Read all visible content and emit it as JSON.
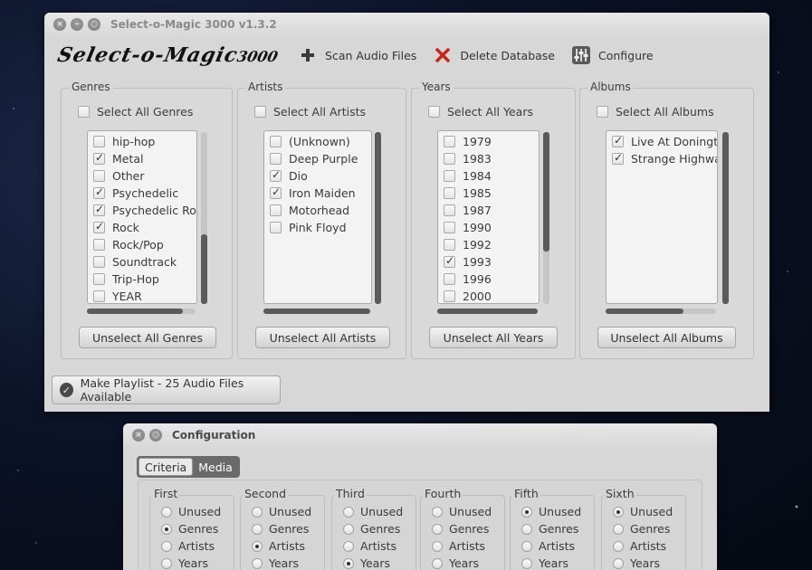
{
  "main_window": {
    "title": "Select-o-Magic 3000 v1.3.2",
    "logo": {
      "text": "Select-o-Magic",
      "num": "3000"
    },
    "toolbar": {
      "scan": "Scan Audio Files",
      "delete": "Delete Database",
      "configure": "Configure"
    },
    "panels": [
      {
        "label": "Genres",
        "select_all": "Select All Genres",
        "unselect_all": "Unselect All Genres",
        "items": [
          {
            "label": "hip-hop",
            "checked": false
          },
          {
            "label": "Metal",
            "checked": true
          },
          {
            "label": "Other",
            "checked": false
          },
          {
            "label": "Psychedelic",
            "checked": true
          },
          {
            "label": "Psychedelic Rock",
            "checked": true
          },
          {
            "label": "Rock",
            "checked": true
          },
          {
            "label": "Rock/Pop",
            "checked": false
          },
          {
            "label": "Soundtrack",
            "checked": false
          },
          {
            "label": "Trip-Hop",
            "checked": false
          },
          {
            "label": "YEAR",
            "checked": false
          }
        ]
      },
      {
        "label": "Artists",
        "select_all": "Select All Artists",
        "unselect_all": "Unselect All Artists",
        "items": [
          {
            "label": "(Unknown)",
            "checked": false
          },
          {
            "label": "Deep Purple",
            "checked": false
          },
          {
            "label": "Dio",
            "checked": true
          },
          {
            "label": "Iron Maiden",
            "checked": true
          },
          {
            "label": "Motorhead",
            "checked": false
          },
          {
            "label": "Pink Floyd",
            "checked": false
          }
        ]
      },
      {
        "label": "Years",
        "select_all": "Select All Years",
        "unselect_all": "Unselect All Years",
        "items": [
          {
            "label": "1979",
            "checked": false
          },
          {
            "label": "1983",
            "checked": false
          },
          {
            "label": "1984",
            "checked": false
          },
          {
            "label": "1985",
            "checked": false
          },
          {
            "label": "1987",
            "checked": false
          },
          {
            "label": "1990",
            "checked": false
          },
          {
            "label": "1992",
            "checked": false
          },
          {
            "label": "1993",
            "checked": true
          },
          {
            "label": "1996",
            "checked": false
          },
          {
            "label": "2000",
            "checked": false
          }
        ]
      },
      {
        "label": "Albums",
        "select_all": "Select All Albums",
        "unselect_all": "Unselect All Albums",
        "items": [
          {
            "label": "Live At Donington",
            "checked": true
          },
          {
            "label": "Strange Highways",
            "checked": true
          }
        ]
      }
    ],
    "make_playlist": "Make Playlist - 25 Audio Files Available"
  },
  "config_window": {
    "title": "Configuration",
    "tabs": [
      "Criteria",
      "Media"
    ],
    "active_tab": "Criteria",
    "criteria": [
      {
        "label": "First",
        "options": [
          "Unused",
          "Genres",
          "Artists",
          "Years"
        ],
        "selected": "Genres"
      },
      {
        "label": "Second",
        "options": [
          "Unused",
          "Genres",
          "Artists",
          "Years"
        ],
        "selected": "Artists"
      },
      {
        "label": "Third",
        "options": [
          "Unused",
          "Genres",
          "Artists",
          "Years"
        ],
        "selected": "Years"
      },
      {
        "label": "Fourth",
        "options": [
          "Unused",
          "Genres",
          "Artists",
          "Years"
        ],
        "selected": ""
      },
      {
        "label": "Fifth",
        "options": [
          "Unused",
          "Genres",
          "Artists",
          "Years"
        ],
        "selected": "Unused"
      },
      {
        "label": "Sixth",
        "options": [
          "Unused",
          "Genres",
          "Artists",
          "Years"
        ],
        "selected": "Unused"
      }
    ]
  }
}
